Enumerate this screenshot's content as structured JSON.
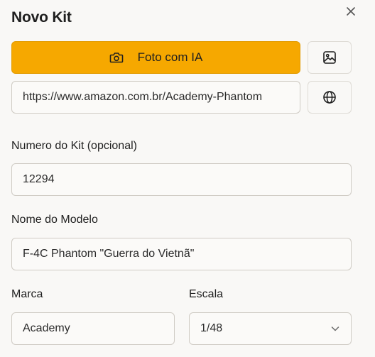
{
  "dialog": {
    "title": "Novo Kit",
    "close_icon": "close-icon"
  },
  "actions": {
    "photo_button_label": "Foto com IA",
    "photo_button_icon": "camera-icon",
    "image_button_icon": "image-icon",
    "link_button_icon": "globe-icon",
    "accent_color": "#f6a800"
  },
  "url_field": {
    "value": "https://www.amazon.com.br/Academy-Phantom"
  },
  "kit_number": {
    "label": "Numero do Kit (opcional)",
    "value": "12294"
  },
  "model_name": {
    "label": "Nome do Modelo",
    "value": "F-4C Phantom \"Guerra do Vietnã\""
  },
  "brand": {
    "label": "Marca",
    "value": "Academy"
  },
  "scale": {
    "label": "Escala",
    "value": "1/48",
    "dropdown_icon": "chevron-down-icon"
  }
}
